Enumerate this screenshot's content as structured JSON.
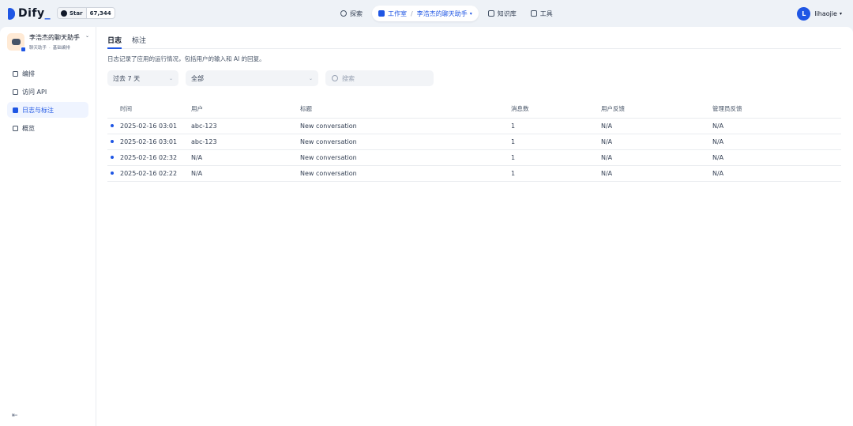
{
  "brand": {
    "name": "Dify",
    "accent": "#1f56e4"
  },
  "github": {
    "star_label": "Star",
    "count": "67,344"
  },
  "nav": {
    "explore": "探索",
    "studio": "工作室",
    "separator": "/",
    "current_app": "李浩杰的聊天助手",
    "knowledge": "知识库",
    "tools": "工具"
  },
  "user": {
    "initial": "L",
    "name": "lihaojie"
  },
  "app": {
    "name": "李浩杰的聊天助手",
    "type": "聊天助手",
    "mode": "基础编排"
  },
  "sidebar": {
    "items": [
      {
        "label": "编排",
        "icon": "orchestrate-icon"
      },
      {
        "label": "访问 API",
        "icon": "api-icon"
      },
      {
        "label": "日志与标注",
        "icon": "logs-icon",
        "active": true
      },
      {
        "label": "概览",
        "icon": "overview-icon"
      }
    ]
  },
  "tabs": {
    "logs": "日志",
    "annotations": "标注"
  },
  "description": "日志记录了应用的运行情况，包括用户的输入和 AI 的回复。",
  "filters": {
    "period": "过去 7 天",
    "status": "全部",
    "search_placeholder": "搜索"
  },
  "table": {
    "headers": {
      "time": "时间",
      "user": "用户",
      "title": "标题",
      "messages": "消息数",
      "user_feedback": "用户反馈",
      "admin_feedback": "管理员反馈"
    },
    "rows": [
      {
        "time": "2025-02-16 03:01",
        "user": "abc-123",
        "title": "New conversation",
        "messages": "1",
        "user_feedback": "N/A",
        "admin_feedback": "N/A"
      },
      {
        "time": "2025-02-16 03:01",
        "user": "abc-123",
        "title": "New conversation",
        "messages": "1",
        "user_feedback": "N/A",
        "admin_feedback": "N/A"
      },
      {
        "time": "2025-02-16 02:32",
        "user": "N/A",
        "title": "New conversation",
        "messages": "1",
        "user_feedback": "N/A",
        "admin_feedback": "N/A"
      },
      {
        "time": "2025-02-16 02:22",
        "user": "N/A",
        "title": "New conversation",
        "messages": "1",
        "user_feedback": "N/A",
        "admin_feedback": "N/A"
      }
    ]
  }
}
